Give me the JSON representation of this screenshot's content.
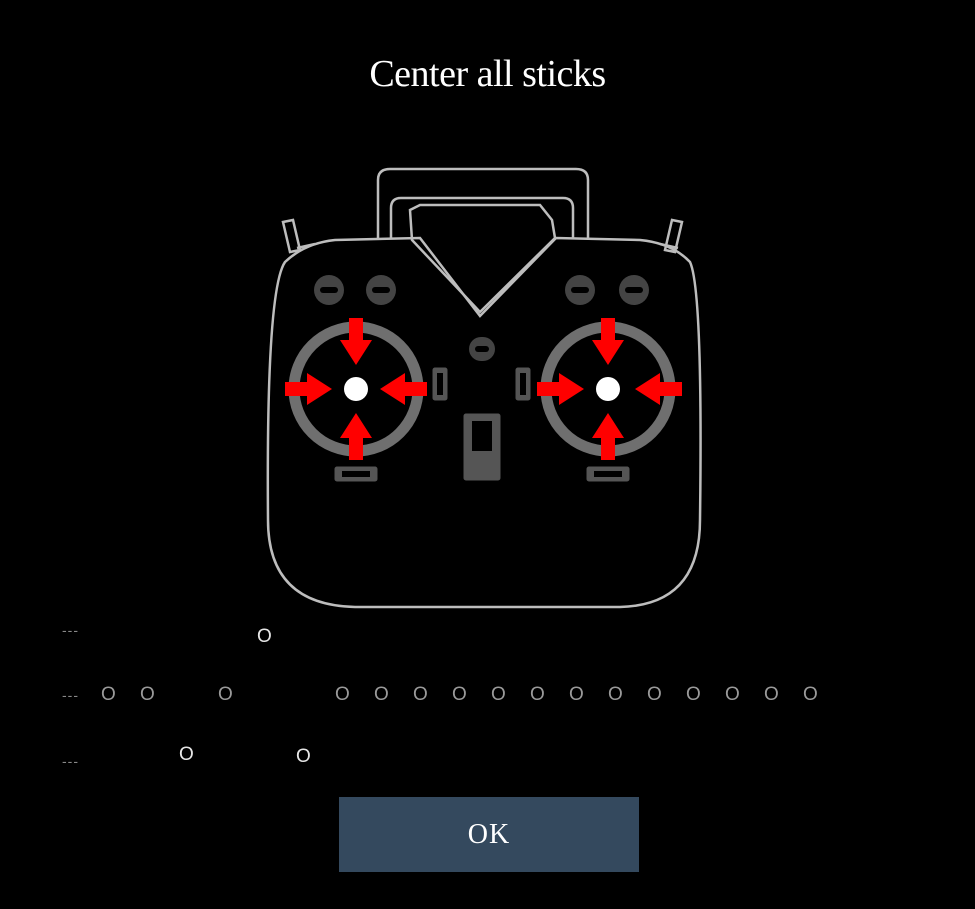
{
  "title": "Center all sticks",
  "ok_label": "OK",
  "colors": {
    "arrow": "#ff0000",
    "button": "#34495e",
    "outline": "#bdbdbd"
  },
  "channel_rows": [
    {
      "dash": "---",
      "marks": [
        {
          "text": "O",
          "hi": true
        }
      ]
    },
    {
      "dash": "---",
      "marks": [
        {
          "text": "O"
        },
        {
          "text": "O"
        },
        {
          "text": "O"
        },
        {
          "text": "O"
        },
        {
          "text": "O"
        },
        {
          "text": "O"
        },
        {
          "text": "O"
        },
        {
          "text": "O"
        },
        {
          "text": "O"
        },
        {
          "text": "O"
        },
        {
          "text": "O"
        },
        {
          "text": "O"
        },
        {
          "text": "O"
        },
        {
          "text": "O"
        },
        {
          "text": "O"
        },
        {
          "text": "O"
        }
      ]
    },
    {
      "dash": "---",
      "marks": [
        {
          "text": "O",
          "hi": true
        },
        {
          "text": "O",
          "hi": true
        }
      ]
    }
  ]
}
